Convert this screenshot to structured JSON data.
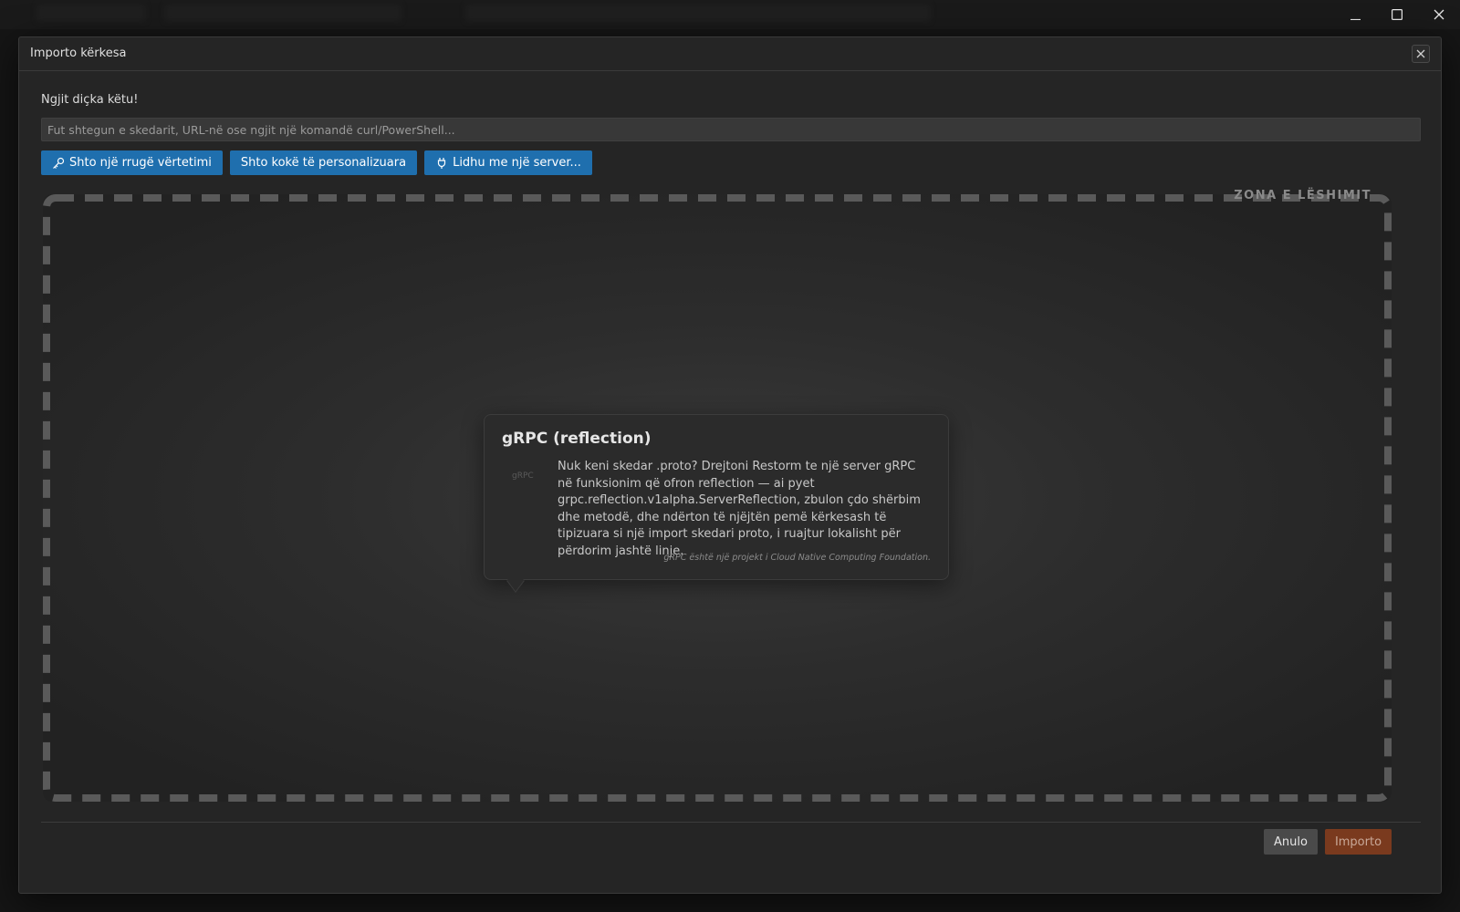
{
  "window": {
    "controls": [
      "minimize",
      "maximize",
      "close"
    ]
  },
  "dialog": {
    "title": "Importo kërkesa",
    "close_icon": "close-icon"
  },
  "paste": {
    "label": "Ngjit diçka këtu!",
    "placeholder": "Fut shtegun e skedarit, URL-në ose ngjit një komandë curl/PowerShell...",
    "value": ""
  },
  "actions": {
    "add_auth_path": {
      "label": "Shto një rrugë vërtetimi",
      "icon": "key-icon"
    },
    "add_custom_headers": {
      "label": "Shto kokë të personalizuara"
    },
    "connect_server": {
      "label": "Lidhu me një server...",
      "icon": "plug-icon"
    }
  },
  "dropzone": {
    "label": "ZONA E LËSHIMIT"
  },
  "card": {
    "title": "gRPC (reflection)",
    "logo_text": "gRPC",
    "description": "Nuk keni skedar .proto? Drejtoni Restorm te një server gRPC në funksionim që ofron reflection — ai pyet grpc.reflection.v1alpha.ServerReflection, zbulon çdo shërbim dhe metodë, dhe ndërton të njëjtën pemë kërkesash të tipizuara si një import skedari proto, i ruajtur lokalisht për përdorim jashtë linje.",
    "footnote": "gRPC është një projekt i Cloud Native Computing Foundation."
  },
  "footer": {
    "cancel_label": "Anulo",
    "import_label": "Importo"
  },
  "colors": {
    "primary_button": "#1f6fae",
    "import_button": "#7a3a1e",
    "dialog_bg": "#252525"
  }
}
